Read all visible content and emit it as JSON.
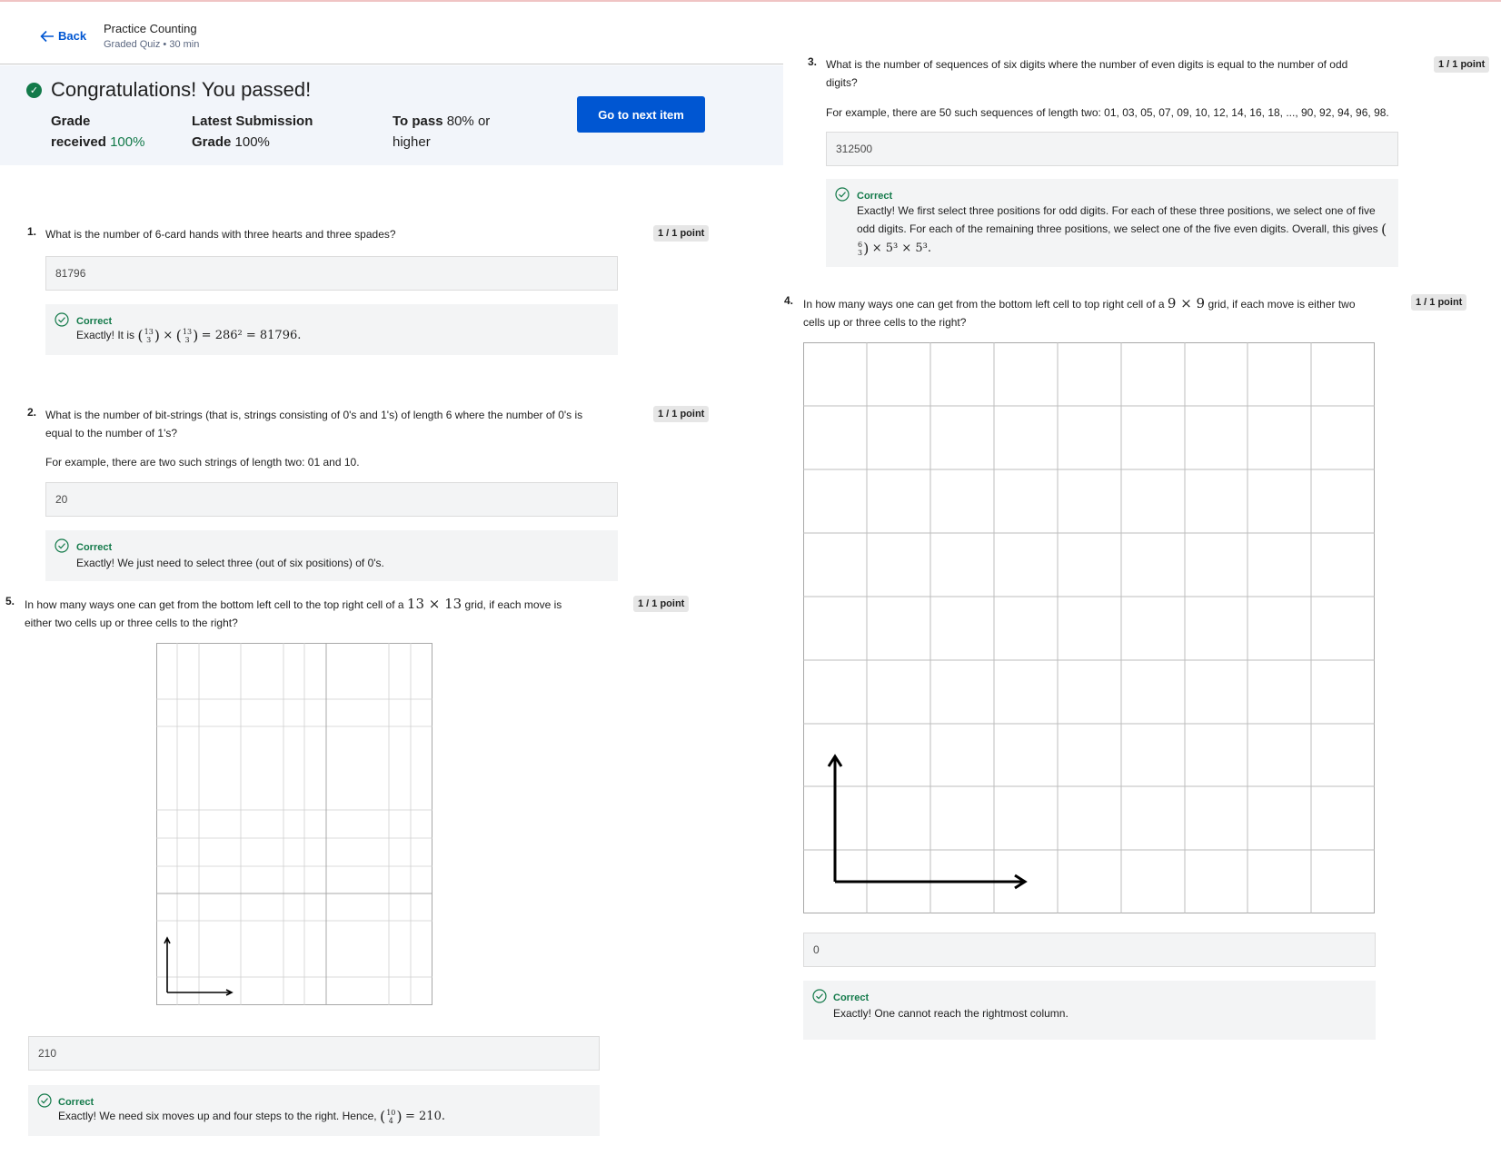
{
  "header": {
    "back_label": "Back",
    "title": "Practice Counting",
    "subtitle": "Graded Quiz • 30 min"
  },
  "banner": {
    "message": "Congratulations! You passed!",
    "grade_label_1": "Grade",
    "grade_label_2": "received",
    "grade_value": "100%",
    "latest_label_1": "Latest Submission",
    "latest_label_2": "Grade",
    "latest_value": "100%",
    "pass_label": "To pass",
    "pass_value": "80% or",
    "pass_value_2": "higher",
    "next_button": "Go to next item"
  },
  "questions": [
    {
      "number": "1.",
      "text": "What is the number of 6-card hands with three hearts and three spades?",
      "points": "1 / 1 point",
      "answer": "81796",
      "feedback_label": "Correct",
      "feedback_prefix": "Exactly! It is",
      "feedback_math": "= 286² = 81796."
    },
    {
      "number": "2.",
      "text": "What is the number of bit-strings (that is, strings consisting of 0's and 1's) of length 6 where the number of 0's is equal to the number of 1's?",
      "example": "For example, there are two such strings of length two: 01 and 10.",
      "points": "1 / 1 point",
      "answer": "20",
      "feedback_label": "Correct",
      "feedback_text": "Exactly! We just need to select three (out of six positions) of 0's."
    },
    {
      "number": "3.",
      "text": "What is the number of sequences of six digits where the number of even digits is equal to the number of odd digits?",
      "example": "For example, there are 50 such sequences of length two: 01, 03, 05, 07, 09, 10, 12, 14, 16, 18, ..., 90, 92, 94, 96, 98.",
      "points": "1 / 1 point",
      "answer": "312500",
      "feedback_label": "Correct",
      "feedback_text": "Exactly! We first select three positions for odd digits. For each of these three positions, we select one of five odd digits. For each of the remaining three positions, we select one of the five even digits. Overall, this",
      "feedback_gives": "gives",
      "feedback_math": "× 5³ × 5³."
    },
    {
      "number": "4.",
      "text_a": "In how many ways one can get from the bottom left cell to top right cell of a",
      "grid_expr": "9 × 9",
      "text_b": "grid, if each move is either two cells up or three cells to the right?",
      "points": "1 / 1 point",
      "answer": "0",
      "feedback_label": "Correct",
      "feedback_text": "Exactly! One cannot reach the rightmost column."
    },
    {
      "number": "5.",
      "text_a": "In how many ways one can get from the bottom left cell to the top right cell of a",
      "grid_expr": "13 × 13",
      "text_b": "grid, if each move is either two cells up or three cells to the right?",
      "points": "1 / 1 point",
      "answer": "210",
      "feedback_label": "Correct",
      "feedback_prefix": "Exactly! We need six moves up and four steps to the right. Hence,",
      "feedback_math": "= 210."
    }
  ],
  "binoms": {
    "q1_a_top": "13",
    "q1_a_bot": "3",
    "q1_b_top": "13",
    "q1_b_bot": "3",
    "q3_top": "6",
    "q3_bot": "3",
    "q5_top": "10",
    "q5_bot": "4"
  },
  "colors": {
    "accent": "#0056d2",
    "success": "#137a4a",
    "banner_bg": "#f2f5fa",
    "answer_bg": "#f3f4f5"
  },
  "icons": [
    "arrow-left-icon",
    "check-circle-filled-icon",
    "check-circle-outline-icon"
  ]
}
